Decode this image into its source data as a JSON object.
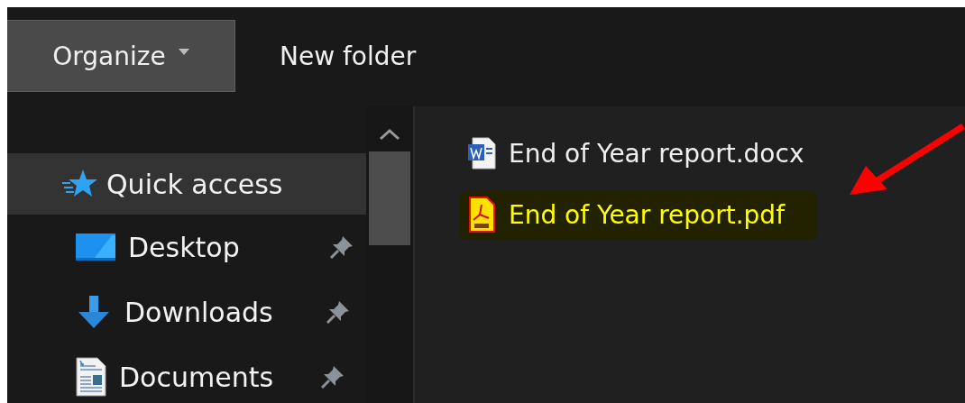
{
  "toolbar": {
    "buttons": [
      {
        "label": "Organize",
        "kind": "dropdown"
      },
      {
        "label": "New folder",
        "kind": "plain"
      }
    ]
  },
  "navigation": {
    "items": [
      {
        "label": "Quick access",
        "kind": "star",
        "selected": true,
        "pinned": false,
        "children": [
          {
            "label": "Desktop",
            "kind": "desktop",
            "selected": false,
            "pinned": true
          },
          {
            "label": "Downloads",
            "kind": "download",
            "selected": false,
            "pinned": true
          },
          {
            "label": "Documents",
            "kind": "document",
            "selected": false,
            "pinned": true
          }
        ]
      }
    ]
  },
  "files": [
    {
      "name": "End of Year report.docx",
      "kind": "docx",
      "highlighted": false
    },
    {
      "name": "End of Year report.pdf",
      "kind": "pdf",
      "highlighted": true
    }
  ],
  "annotations": [
    {
      "kind": "arrow"
    }
  ]
}
